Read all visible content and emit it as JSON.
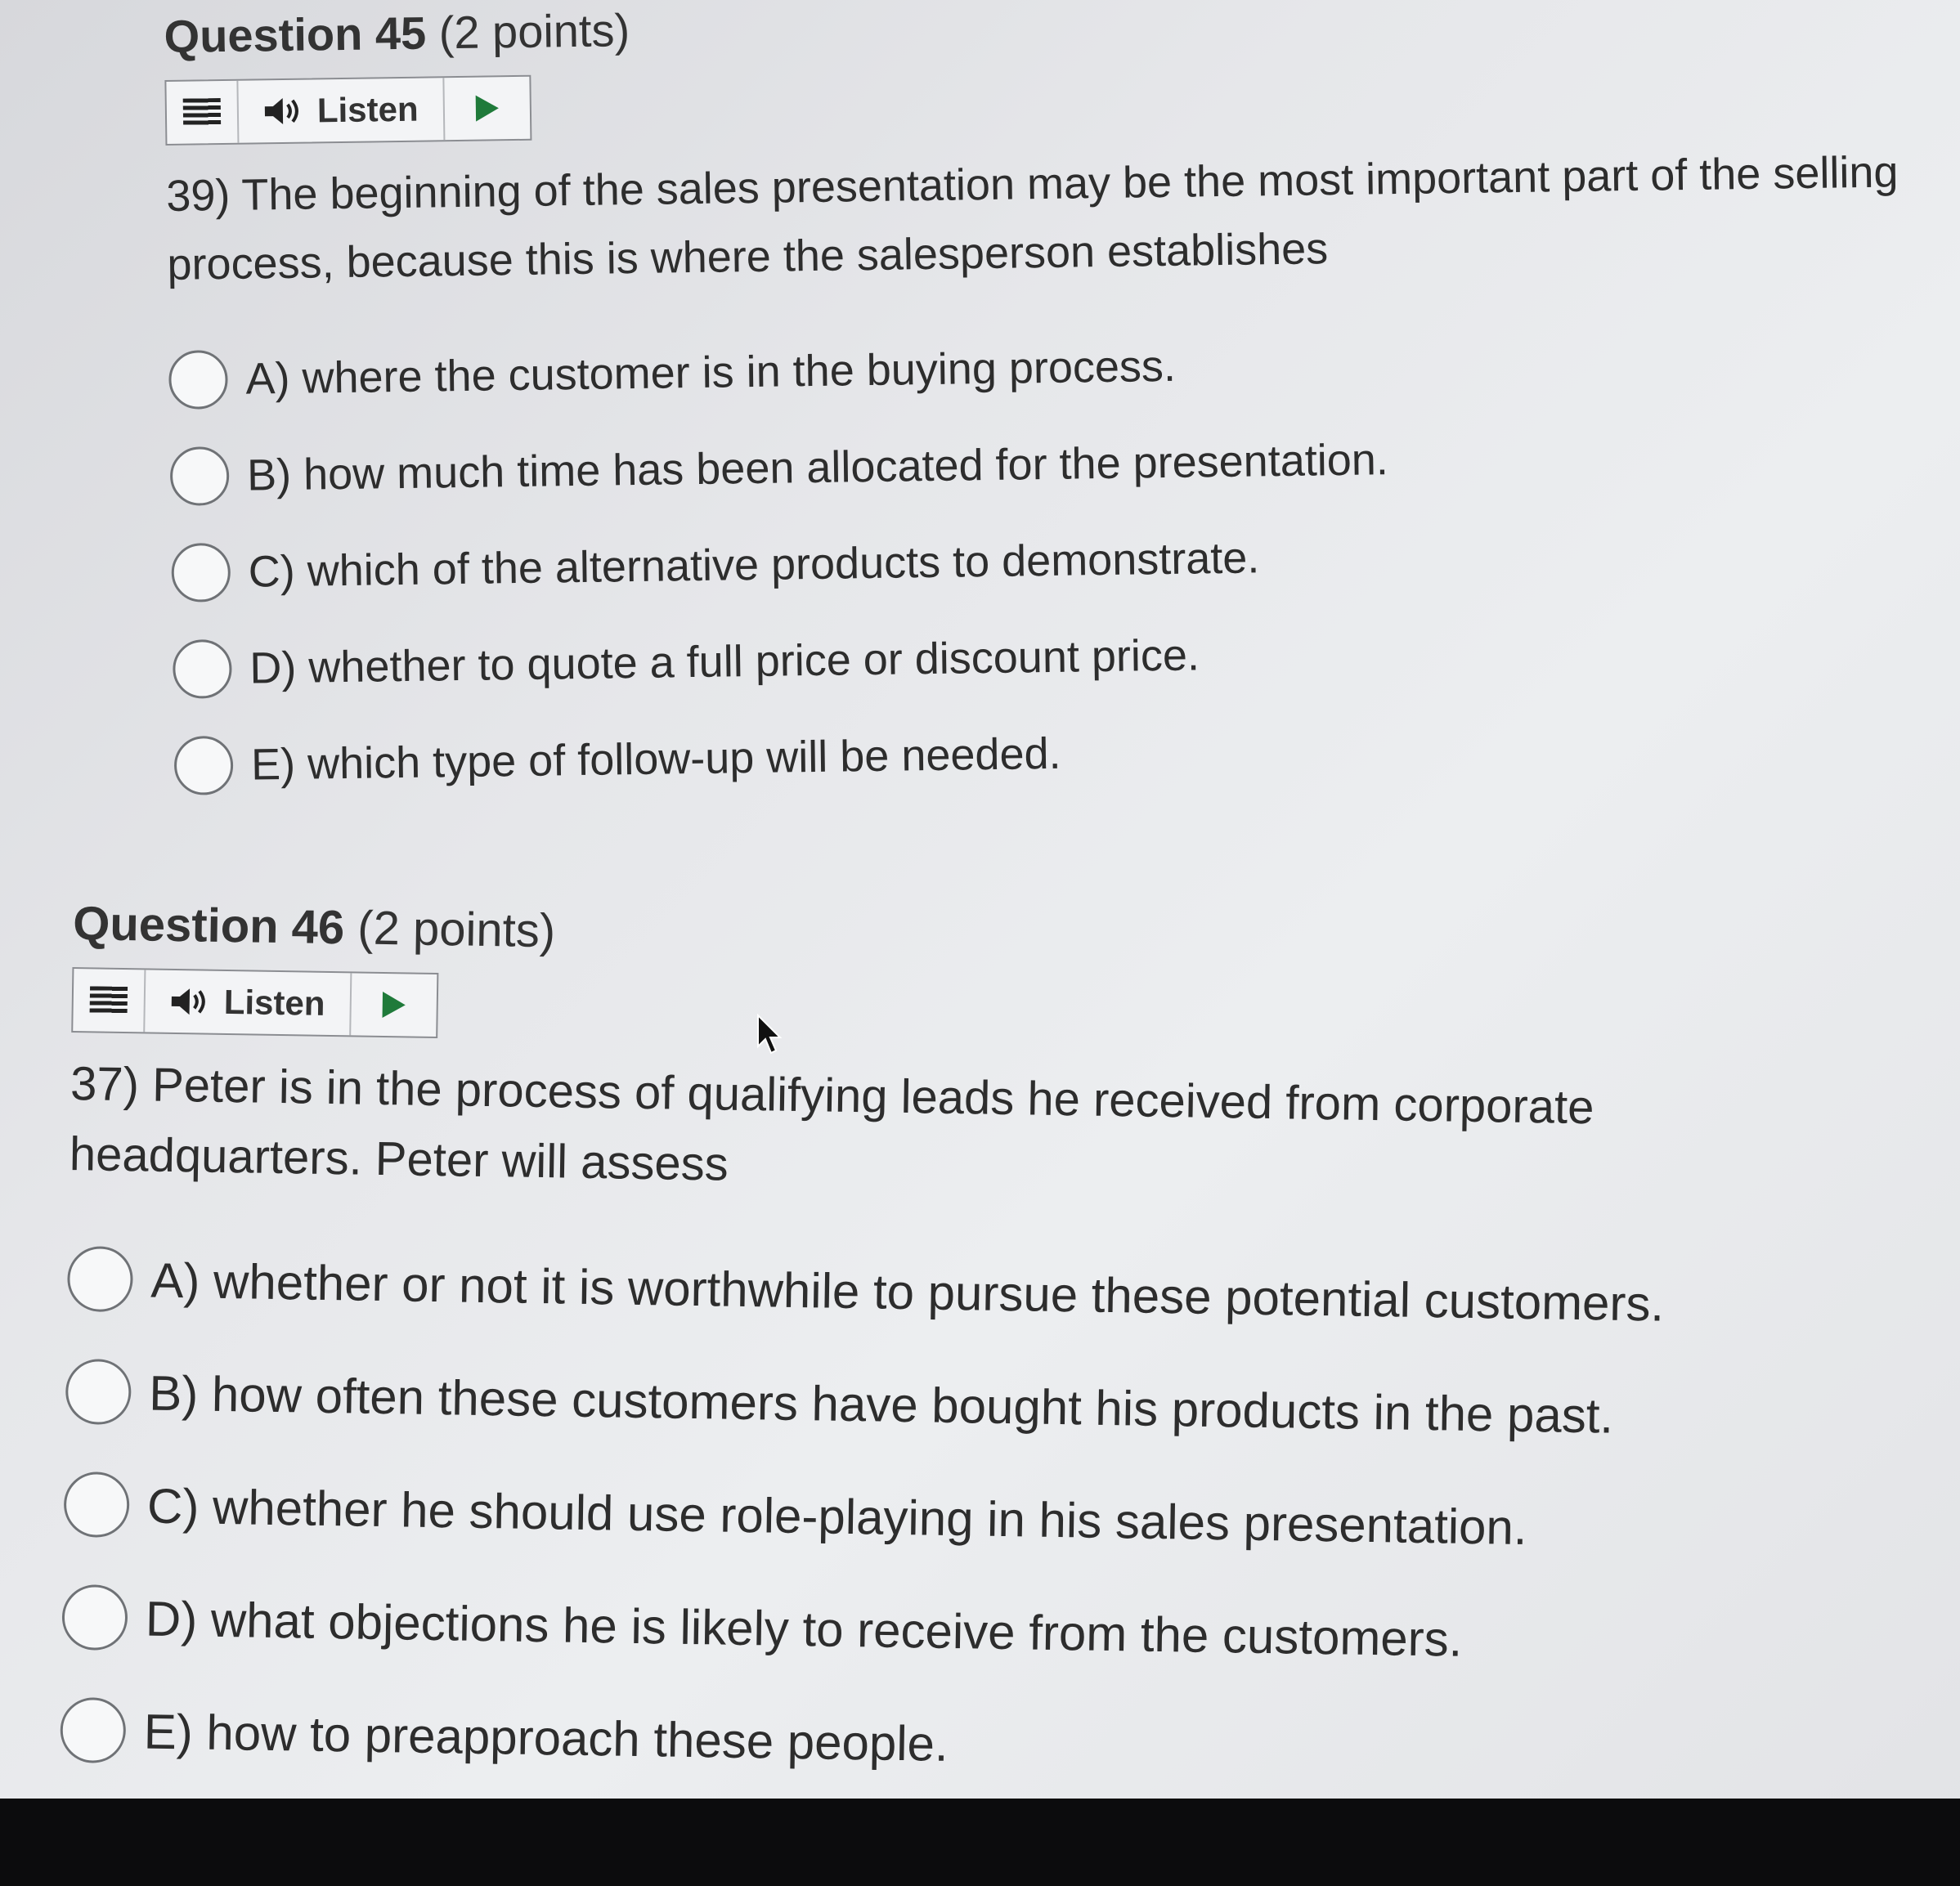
{
  "questions": [
    {
      "title_number": "Question 45",
      "title_points": "(2 points)",
      "listen_label": "Listen",
      "text": "39) The beginning of the sales presentation may be the most important part of the selling process, because this is where the salesperson establishes",
      "choices": [
        "A) where the customer is in the buying process.",
        "B) how much time has been allocated for the presentation.",
        "C) which of the alternative products to demonstrate.",
        "D) whether to quote a full price or discount price.",
        "E) which type of follow-up will be needed."
      ]
    },
    {
      "title_number": "Question 46",
      "title_points": "(2 points)",
      "listen_label": "Listen",
      "text": "37) Peter is in the process of qualifying leads he received from corporate headquarters. Peter will assess",
      "choices": [
        "A) whether or not it is worthwhile to pursue these potential customers.",
        "B) how often these customers have bought his products in the past.",
        "C) whether he should use role-playing in his sales presentation.",
        "D) what objections he is likely to receive from the customers.",
        "E) how to preapproach these people."
      ]
    }
  ],
  "icons": {
    "menu": "menu-icon",
    "speaker": "speaker-icon",
    "play": "play-icon",
    "cursor": "mouse-pointer-icon"
  },
  "colors": {
    "play_accent": "#1f7a3a",
    "text": "#2d2d2d"
  }
}
